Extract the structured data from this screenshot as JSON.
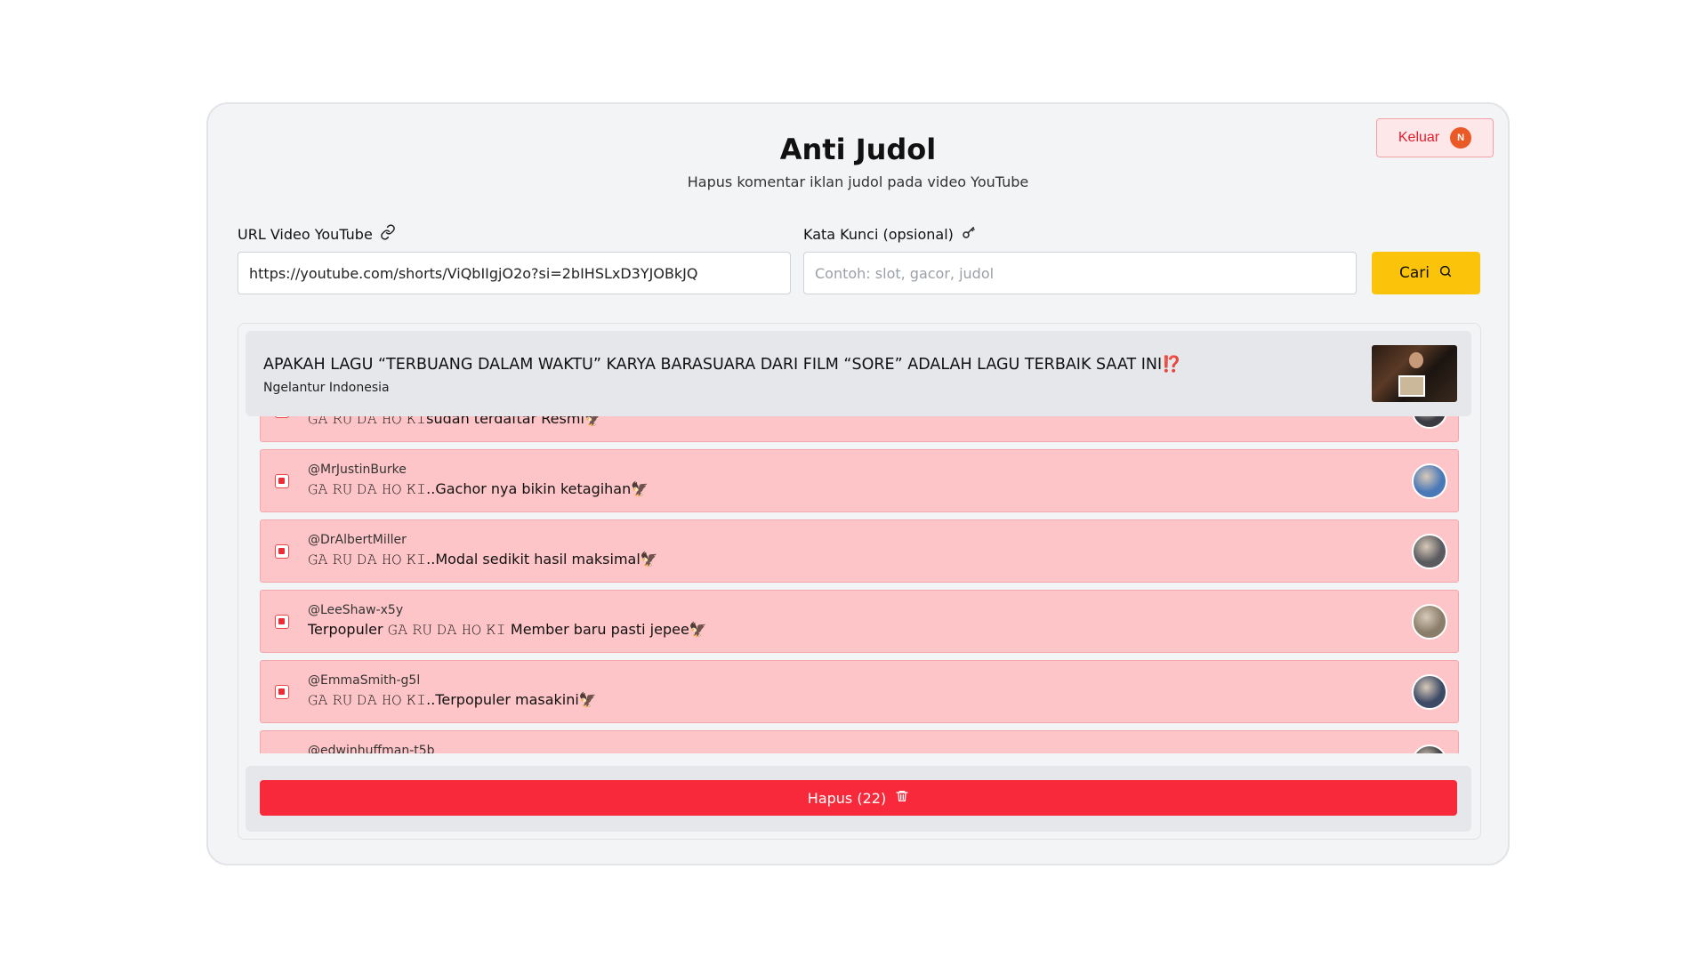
{
  "header": {
    "title": "Anti Judol",
    "subtitle": "Hapus komentar iklan judol pada video YouTube",
    "logout_label": "Keluar",
    "user_initial": "N"
  },
  "form": {
    "url_label": "URL Video YouTube",
    "url_value": "https://youtube.com/shorts/ViQbIIgjO2o?si=2bIHSLxD3YJOBkJQ",
    "keyword_label": "Kata Kunci (opsional)",
    "keyword_placeholder": "Contoh: slot, gacor, judol",
    "search_label": "Cari"
  },
  "video": {
    "title": "APAKAH LAGU “TERBUANG DALAM WAKTU” KARYA BARASUARA DARI FILM “SORE” ADALAH LAGU TERBAIK SAAT INI",
    "title_mark": "⁉️",
    "channel": "Ngelantur Indonesia"
  },
  "comments": [
    {
      "author": "",
      "text": "𝙶𝙰 𝚁𝚄 𝙳𝙰 𝙷𝙾 𝙺𝙸sudah terdaftar Resmi🦅",
      "avatar_color": "#3b3b44"
    },
    {
      "author": "@MrJustinBurke",
      "text": "𝙶𝙰 𝚁𝚄 𝙳𝙰 𝙷𝙾 𝙺𝙸..Gachor nya bikin ketagihan🦅",
      "avatar_color": "#4a79b8"
    },
    {
      "author": "@DrAlbertMiller",
      "text": "𝙶𝙰 𝚁𝚄 𝙳𝙰 𝙷𝙾 𝙺𝙸..Modal sedikit hasil maksimal🦅",
      "avatar_color": "#5a5a5f"
    },
    {
      "author": "@LeeShaw-x5y",
      "text": "Terpopuler 𝙶𝙰 𝚁𝚄 𝙳𝙰 𝙷𝙾 𝙺𝙸 Member baru pasti jepee🦅",
      "avatar_color": "#8a7e6a"
    },
    {
      "author": "@EmmaSmith-g5l",
      "text": "𝙶𝙰 𝚁𝚄 𝙳𝙰 𝙷𝙾 𝙺𝙸..Terpopuler masakini🦅",
      "avatar_color": "#3d4a66"
    },
    {
      "author": "@edwinhuffman-t5b",
      "text": "",
      "avatar_color": "#3a3a40"
    }
  ],
  "footer": {
    "delete_label": "Hapus (22)"
  },
  "colors": {
    "accent_yellow": "#fbc40a",
    "danger_red": "#f8293a",
    "comment_bg": "#fec5c8"
  }
}
